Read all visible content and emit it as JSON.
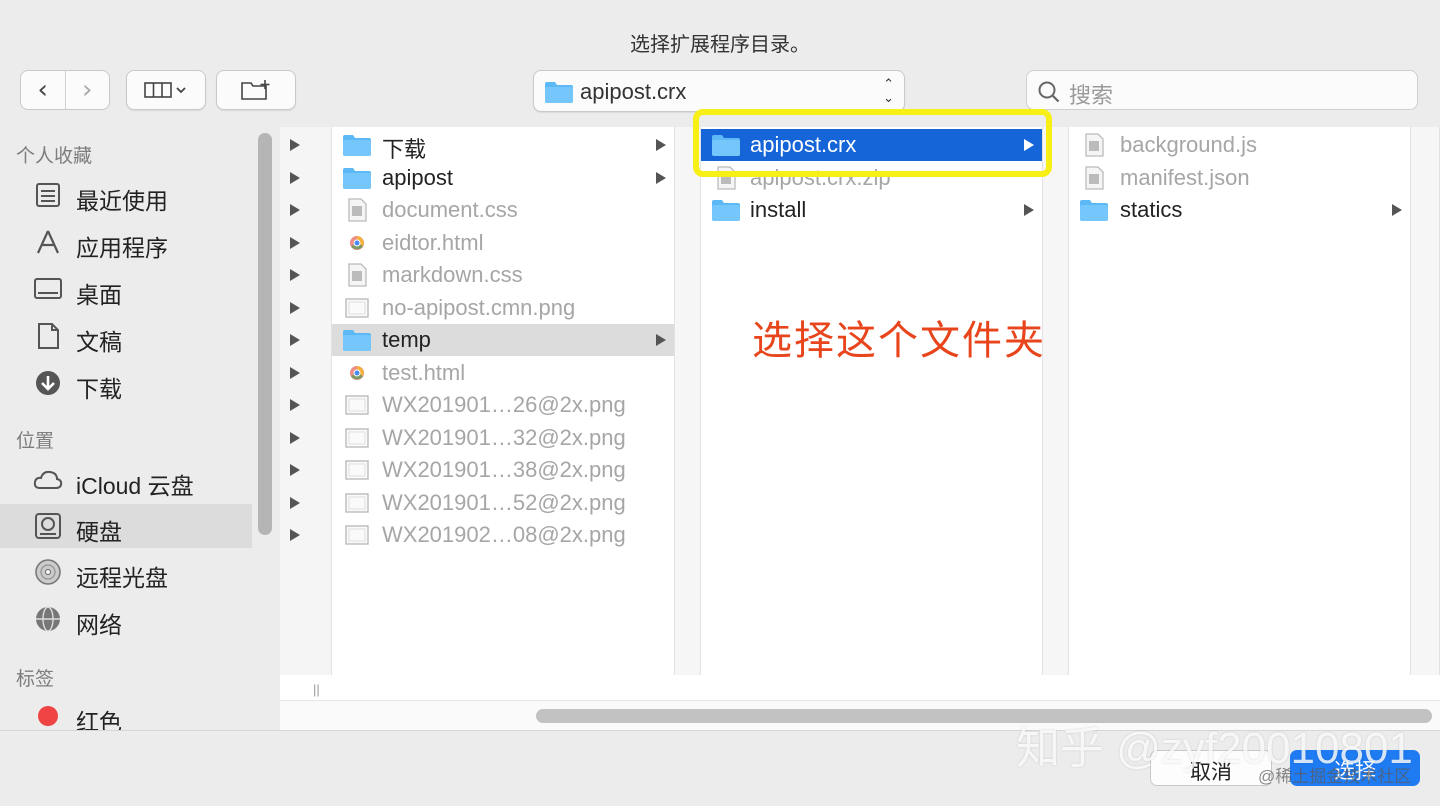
{
  "dialog": {
    "title": "选择扩展程序目录。"
  },
  "toolbar": {
    "popup_value": "apipost.crx",
    "search_placeholder": "搜索"
  },
  "sidebar": {
    "sections": [
      {
        "heading": "个人收藏",
        "items": [
          {
            "label": "最近使用",
            "icon": "recents-icon"
          },
          {
            "label": "应用程序",
            "icon": "applications-icon"
          },
          {
            "label": "桌面",
            "icon": "desktop-icon"
          },
          {
            "label": "文稿",
            "icon": "documents-icon"
          },
          {
            "label": "下载",
            "icon": "downloads-icon"
          }
        ]
      },
      {
        "heading": "位置",
        "items": [
          {
            "label": "iCloud 云盘",
            "icon": "icloud-icon"
          },
          {
            "label": "硬盘",
            "icon": "hard-disk-icon",
            "selected": true
          },
          {
            "label": "远程光盘",
            "icon": "remote-disc-icon"
          },
          {
            "label": "网络",
            "icon": "network-icon"
          }
        ]
      },
      {
        "heading": "标签",
        "items": [
          {
            "label": "红色",
            "icon": "red-tag-icon",
            "color": "#f04444"
          }
        ]
      }
    ]
  },
  "columns": {
    "col1": [
      {
        "name": "下载",
        "kind": "folder",
        "enabled": true,
        "arrow": true
      },
      {
        "name": "apipost",
        "kind": "folder",
        "enabled": true,
        "arrow": true
      },
      {
        "name": "document.css",
        "kind": "file",
        "enabled": false
      },
      {
        "name": "eidtor.html",
        "kind": "html",
        "enabled": false
      },
      {
        "name": "markdown.css",
        "kind": "file",
        "enabled": false
      },
      {
        "name": "no-apipost.cmn.png",
        "kind": "image",
        "enabled": false
      },
      {
        "name": "temp",
        "kind": "folder",
        "enabled": true,
        "arrow": true,
        "selected": true
      },
      {
        "name": "test.html",
        "kind": "html",
        "enabled": false
      },
      {
        "name": "WX201901…26@2x.png",
        "kind": "image",
        "enabled": false
      },
      {
        "name": "WX201901…32@2x.png",
        "kind": "image",
        "enabled": false
      },
      {
        "name": "WX201901…38@2x.png",
        "kind": "image",
        "enabled": false
      },
      {
        "name": "WX201901…52@2x.png",
        "kind": "image",
        "enabled": false
      },
      {
        "name": "WX201902…08@2x.png",
        "kind": "image",
        "enabled": false
      }
    ],
    "col2": [
      {
        "name": "apipost.crx",
        "kind": "folder",
        "enabled": true,
        "arrow": true,
        "active": true
      },
      {
        "name": "apipost.crx.zip",
        "kind": "file",
        "enabled": false
      },
      {
        "name": "install",
        "kind": "folder",
        "enabled": true,
        "arrow": true
      }
    ],
    "col3": [
      {
        "name": "background.js",
        "kind": "file",
        "enabled": false
      },
      {
        "name": "manifest.json",
        "kind": "file",
        "enabled": false
      },
      {
        "name": "statics",
        "kind": "folder",
        "enabled": true,
        "arrow": true
      }
    ]
  },
  "annotation": {
    "text": "选择这个文件夹",
    "color": "#e8451c",
    "highlight_color": "#f7ef16"
  },
  "buttons": {
    "cancel": "取消",
    "choose": "选择"
  },
  "watermark": {
    "line1": "知乎 @zyf20010801",
    "line2": "@稀土掘金技术社区"
  }
}
